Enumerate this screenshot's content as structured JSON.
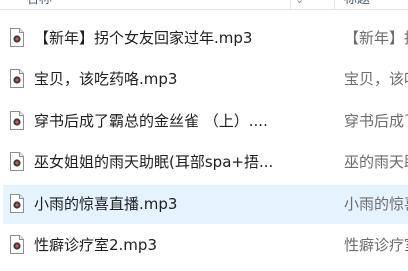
{
  "header": {
    "name_label": "名称",
    "title_label": "标题"
  },
  "files": [
    {
      "name": "【新年】拐个女友回家过年.mp3",
      "title": "【新年】拐个",
      "selected": false
    },
    {
      "name": "宝贝，该吃药咯.mp3",
      "title": "宝贝，该吃",
      "selected": false
    },
    {
      "name": "穿书后成了霸总的金丝雀 （上）....",
      "title": "穿书后成了霸",
      "selected": false
    },
    {
      "name": "巫女姐姐的雨天助眠(耳部spa+捂...",
      "title": "巫的雨天助眠",
      "selected": false
    },
    {
      "name": "小雨的惊喜直播.mp3",
      "title": "小雨的惊喜直",
      "selected": true
    },
    {
      "name": "性癖诊疗室2.mp3",
      "title": "性癖诊疗室2",
      "selected": false
    }
  ],
  "colors": {
    "selection": "#e5f3ff",
    "header_text": "#4c607a",
    "icon_note": "#c0392b"
  }
}
